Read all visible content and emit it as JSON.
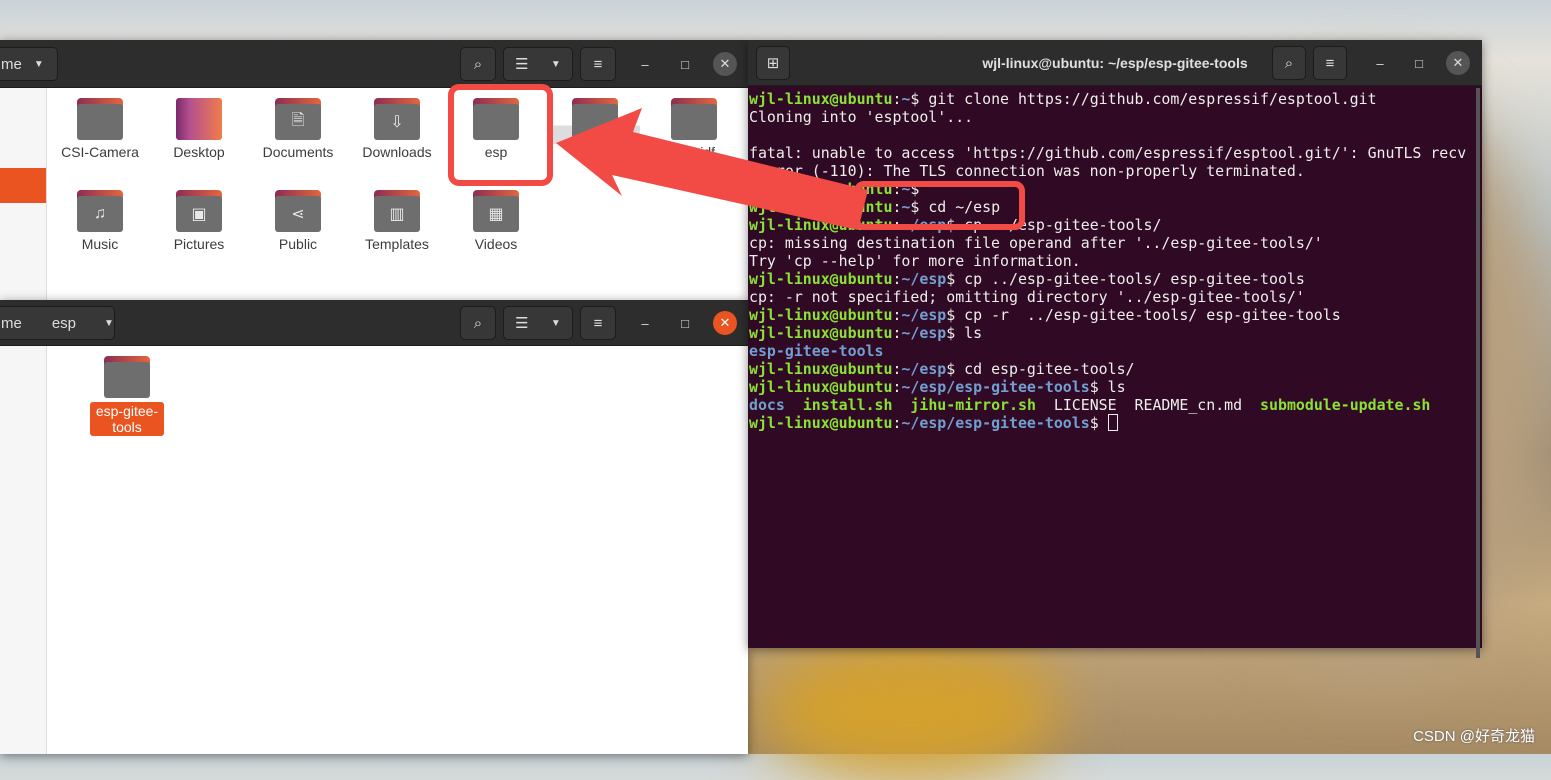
{
  "file_manager_top": {
    "path_segment": "me",
    "items": [
      {
        "label": "CSI-Camera",
        "icon": "folder-icon"
      },
      {
        "label": "Desktop",
        "icon": "desktop-folder-icon"
      },
      {
        "label": "Documents",
        "icon": "document-icon"
      },
      {
        "label": "Downloads",
        "icon": "download-icon"
      },
      {
        "label": "esp",
        "icon": "folder-icon"
      },
      {
        "label": "",
        "icon": "folder-icon"
      },
      {
        "label": "esp-idf",
        "icon": "folder-icon"
      },
      {
        "label": "Music",
        "icon": "music-icon"
      },
      {
        "label": "Pictures",
        "icon": "picture-icon"
      },
      {
        "label": "Public",
        "icon": "share-icon"
      },
      {
        "label": "Templates",
        "icon": "template-icon"
      },
      {
        "label": "Videos",
        "icon": "video-icon"
      }
    ]
  },
  "file_manager_bottom": {
    "path_segments": [
      "me",
      "esp"
    ],
    "items": [
      {
        "label": "esp-gitee-tools",
        "selected": true
      }
    ]
  },
  "terminal": {
    "title": "wjl-linux@ubuntu: ~/esp/esp-gitee-tools",
    "lines": [
      [
        {
          "t": "wjl-linux@ubuntu",
          "c": "u"
        },
        {
          "t": ":",
          "c": "d"
        },
        {
          "t": "~",
          "c": "p"
        },
        {
          "t": "$ git clone https://github.com/espressif/esptool.git",
          "c": "d"
        }
      ],
      [
        {
          "t": "Cloning into 'esptool'...",
          "c": "d"
        }
      ],
      [],
      [
        {
          "t": "fatal: unable to access 'https://github.com/espressif/esptool.git/': GnuTLS recv",
          "c": "d"
        }
      ],
      [
        {
          "t": " error (-110): The TLS connection was non-properly terminated.",
          "c": "d"
        }
      ],
      [
        {
          "t": "wjl-linux@ubuntu",
          "c": "u"
        },
        {
          "t": ":",
          "c": "d"
        },
        {
          "t": "~",
          "c": "p"
        },
        {
          "t": "$",
          "c": "d"
        }
      ],
      [
        {
          "t": "wjl-linux@ubuntu",
          "c": "u"
        },
        {
          "t": ":",
          "c": "d"
        },
        {
          "t": "~",
          "c": "p"
        },
        {
          "t": "$ cd ~/esp",
          "c": "d"
        }
      ],
      [
        {
          "t": "wjl-linux@ubuntu",
          "c": "u"
        },
        {
          "t": ":",
          "c": "d"
        },
        {
          "t": "~/esp",
          "c": "p"
        },
        {
          "t": "$ cp ../esp-gitee-tools/",
          "c": "d"
        }
      ],
      [
        {
          "t": "cp: missing destination file operand after '../esp-gitee-tools/'",
          "c": "d"
        }
      ],
      [
        {
          "t": "Try 'cp --help' for more information.",
          "c": "d"
        }
      ],
      [
        {
          "t": "wjl-linux@ubuntu",
          "c": "u"
        },
        {
          "t": ":",
          "c": "d"
        },
        {
          "t": "~/esp",
          "c": "p"
        },
        {
          "t": "$ cp ../esp-gitee-tools/ esp-gitee-tools",
          "c": "d"
        }
      ],
      [
        {
          "t": "cp: -r not specified; omitting directory '../esp-gitee-tools/'",
          "c": "d"
        }
      ],
      [
        {
          "t": "wjl-linux@ubuntu",
          "c": "u"
        },
        {
          "t": ":",
          "c": "d"
        },
        {
          "t": "~/esp",
          "c": "p"
        },
        {
          "t": "$ cp -r  ../esp-gitee-tools/ esp-gitee-tools",
          "c": "d"
        }
      ],
      [
        {
          "t": "wjl-linux@ubuntu",
          "c": "u"
        },
        {
          "t": ":",
          "c": "d"
        },
        {
          "t": "~/esp",
          "c": "p"
        },
        {
          "t": "$ ls",
          "c": "d"
        }
      ],
      [
        {
          "t": "esp-gitee-tools",
          "c": "b"
        }
      ],
      [
        {
          "t": "wjl-linux@ubuntu",
          "c": "u"
        },
        {
          "t": ":",
          "c": "d"
        },
        {
          "t": "~/esp",
          "c": "p"
        },
        {
          "t": "$ cd esp-gitee-tools/",
          "c": "d"
        }
      ],
      [
        {
          "t": "wjl-linux@ubuntu",
          "c": "u"
        },
        {
          "t": ":",
          "c": "d"
        },
        {
          "t": "~/esp/esp-gitee-tools",
          "c": "p"
        },
        {
          "t": "$ ls",
          "c": "d"
        }
      ],
      [
        {
          "t": "docs",
          "c": "b"
        },
        {
          "t": "  ",
          "c": "d"
        },
        {
          "t": "install.sh",
          "c": "g"
        },
        {
          "t": "  ",
          "c": "d"
        },
        {
          "t": "jihu-mirror.sh",
          "c": "g"
        },
        {
          "t": "  LICENSE  README_cn.md  ",
          "c": "d"
        },
        {
          "t": "submodule-update.sh",
          "c": "g"
        }
      ],
      [
        {
          "t": "wjl-linux@ubuntu",
          "c": "u"
        },
        {
          "t": ":",
          "c": "d"
        },
        {
          "t": "~/esp/esp-gitee-tools",
          "c": "p"
        },
        {
          "t": "$ ",
          "c": "d"
        }
      ]
    ]
  },
  "watermark": "CSDN @好奇龙猫",
  "colors": {
    "annotation": "#f24b46",
    "ubuntu_orange": "#e95420",
    "terminal_bg": "#300a24"
  }
}
